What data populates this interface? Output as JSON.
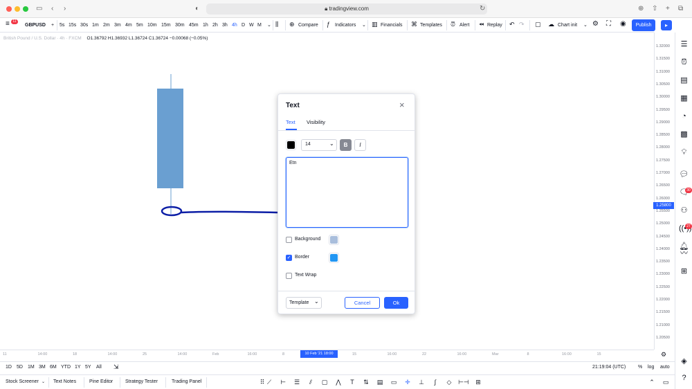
{
  "browser": {
    "url": "tradingview.com"
  },
  "toolbar": {
    "symbol": "GBPUSD",
    "intervals": [
      "5s",
      "15s",
      "30s",
      "1m",
      "2m",
      "3m",
      "4m",
      "5m",
      "10m",
      "15m",
      "30m",
      "45m",
      "1h",
      "2h",
      "3h",
      "4h",
      "D",
      "W",
      "M"
    ],
    "active_interval": "4h",
    "compare": "Compare",
    "indicators": "Indicators",
    "financials": "Financials",
    "templates": "Templates",
    "alert": "Alert",
    "replay": "Replay",
    "layout_name": "Chart init",
    "publish": "Publish",
    "menu_badge": "11"
  },
  "legend": {
    "title": "British Pound / U.S. Dollar · 4h · FXCM",
    "ohlc": "O1.36792  H1.36932  L1.36724  C1.36724  −0.00068 (−0.05%)"
  },
  "price_scale": {
    "labels": [
      "1.32000",
      "1.31500",
      "1.31000",
      "1.30500",
      "1.30000",
      "1.29500",
      "1.29000",
      "1.28500",
      "1.28000",
      "1.27500",
      "1.27000",
      "1.26500",
      "1.26000",
      "1.25500",
      "1.25000",
      "1.24500",
      "1.24000",
      "1.23500",
      "1.23000",
      "1.22500",
      "1.22000",
      "1.21500",
      "1.21000",
      "1.20500"
    ],
    "current": "1.25800"
  },
  "time_axis": {
    "ticks": [
      "11",
      "14:00",
      "18",
      "14:00",
      "25",
      "14:00",
      "Feb",
      "16:00",
      "8",
      "16:00",
      "15",
      "16:00",
      "22",
      "16:00",
      "Mar",
      "8",
      "16:00",
      "15"
    ],
    "highlight": "10 Feb '21  18:00"
  },
  "range_bar": {
    "ranges": [
      "1D",
      "5D",
      "1M",
      "3M",
      "6M",
      "YTD",
      "1Y",
      "5Y",
      "All"
    ],
    "clock": "21:19:04 (UTC)",
    "percent": "%",
    "log": "log",
    "auto": "auto"
  },
  "bottom_bar": {
    "tabs": [
      "Stock Screener",
      "Text Notes",
      "Pine Editor",
      "Strategy Tester",
      "Trading Panel"
    ]
  },
  "dialog": {
    "title": "Text",
    "tabs": [
      "Text",
      "Visibility"
    ],
    "font_size": "14",
    "bold": "B",
    "italic": "I",
    "text_value": "Etn",
    "background_label": "Background",
    "border_label": "Border",
    "wrap_label": "Text Wrap",
    "template": "Template",
    "cancel": "Cancel",
    "ok": "Ok",
    "text_color": "#000000",
    "background_color": "#a9bedc",
    "border_color": "#2196f3",
    "border_checked": true,
    "background_checked": false,
    "wrap_checked": false
  },
  "side_badges": [
    "30",
    "27"
  ],
  "colors": {
    "accent": "#2962ff",
    "candle": "#6a9fd1",
    "drawing": "#0c1ea6"
  }
}
